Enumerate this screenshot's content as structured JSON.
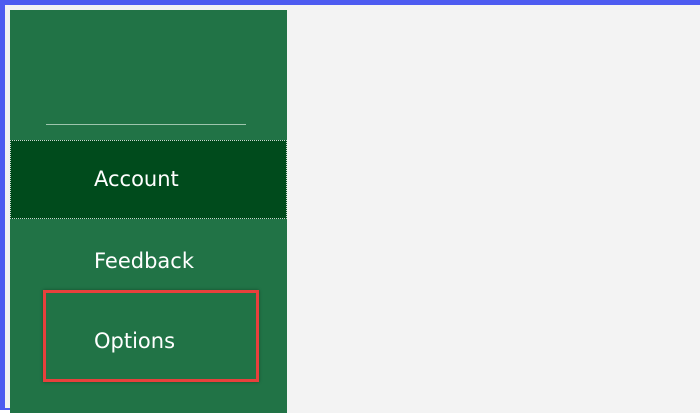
{
  "sidebar": {
    "items": [
      {
        "label": "Account",
        "selected": true
      },
      {
        "label": "Feedback",
        "selected": false
      },
      {
        "label": "Options",
        "selected": false,
        "highlighted": true
      }
    ]
  },
  "colors": {
    "sidebar_bg": "#217346",
    "selected_bg": "#004b1c",
    "content_bg": "#f3f3f3",
    "frame_accent": "#4d5bf0",
    "highlight_border": "#e8403c"
  }
}
